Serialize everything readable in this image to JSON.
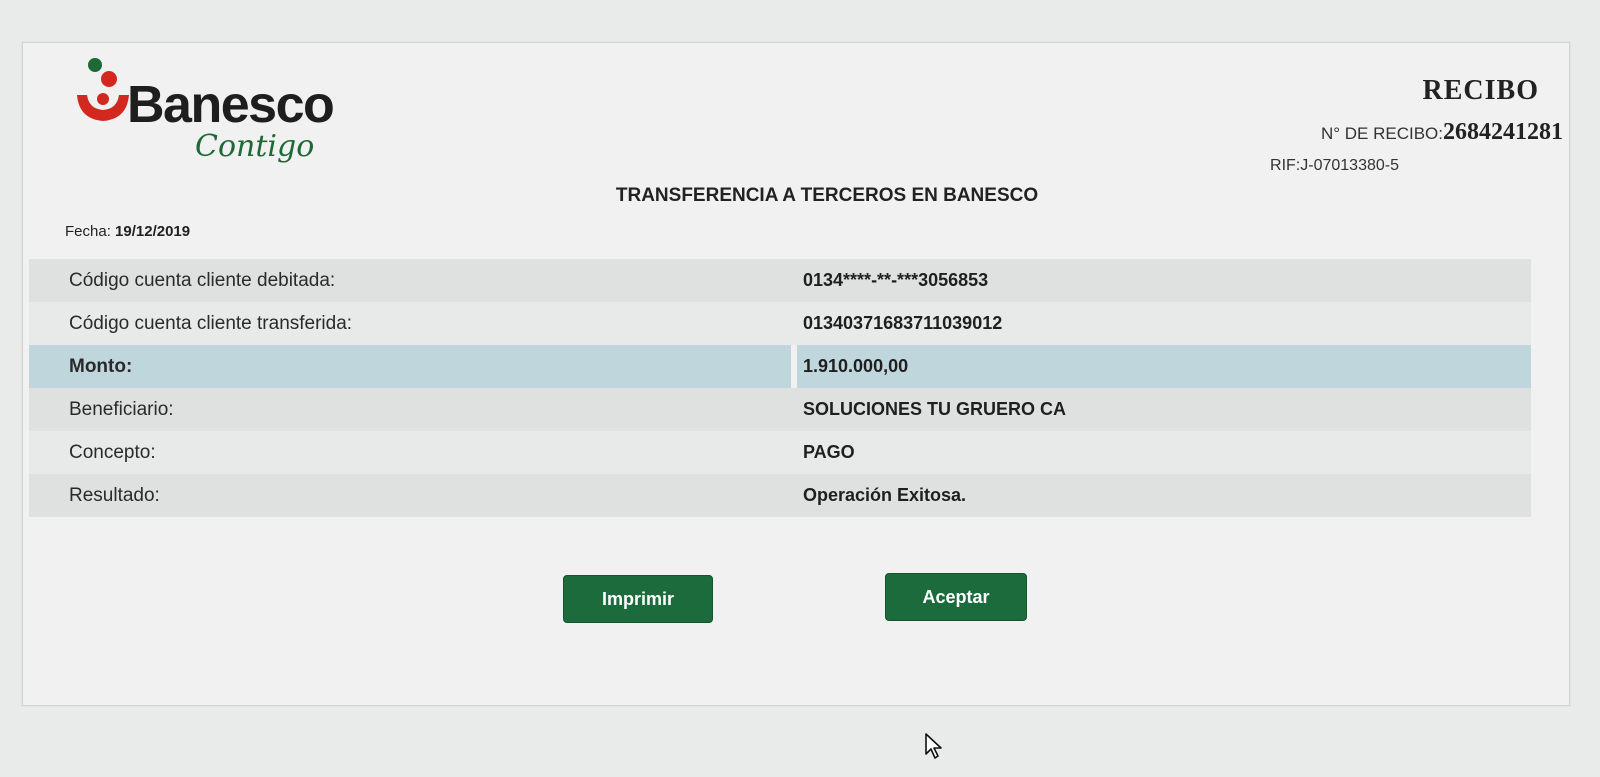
{
  "brand": {
    "name": "Banesco",
    "tagline": "Contigo",
    "colors": {
      "red": "#d2281e",
      "green": "#1d6a36",
      "button_green": "#1b6b3d"
    }
  },
  "header": {
    "title": "RECIBO",
    "receipt_number_label": "N° DE RECIBO:",
    "receipt_number": "2684241281",
    "rif": "RIF:J-07013380-5"
  },
  "page_title": "TRANSFERENCIA A TERCEROS EN BANESCO",
  "date": {
    "label": "Fecha:",
    "value": "19/12/2019"
  },
  "details": [
    {
      "label": "Código cuenta cliente debitada:",
      "value": "0134****-**-***3056853"
    },
    {
      "label": "Código cuenta cliente transferida:",
      "value": "01340371683711039012"
    },
    {
      "label": "Monto:",
      "value": "1.910.000,00"
    },
    {
      "label": "Beneficiario:",
      "value": "SOLUCIONES TU GRUERO CA"
    },
    {
      "label": "Concepto:",
      "value": "PAGO"
    },
    {
      "label": "Resultado:",
      "value": "Operación Exitosa."
    }
  ],
  "buttons": {
    "print": "Imprimir",
    "accept": "Aceptar"
  },
  "icons": {
    "cursor": "mouse-pointer-icon"
  }
}
